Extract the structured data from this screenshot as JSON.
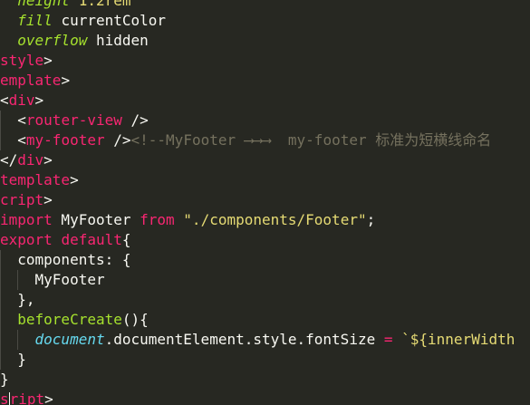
{
  "editor": {
    "theme": "monokai",
    "colors": {
      "background": "#272822",
      "text": "#f8f8f2",
      "tag": "#f92672",
      "keyword": "#f92672",
      "function": "#a6e22e",
      "string": "#e6db74",
      "comment": "#75715e",
      "builtin": "#66d9ef"
    }
  },
  "code": {
    "l1": {
      "prop": "height",
      "value": "1.2rem"
    },
    "l2": {
      "prop": "fill",
      "value": "currentColor"
    },
    "l3": {
      "prop": "overflow",
      "value": "hidden"
    },
    "l4": {
      "name": "style",
      "close": ">"
    },
    "l5": {
      "name": "emplate",
      "close": ">"
    },
    "l6": {
      "open": "<",
      "name": "div",
      "close": ">"
    },
    "l7": {
      "open": "<",
      "name": "router-view",
      "close": " />"
    },
    "l8": {
      "open": "<",
      "name": "my-footer",
      "close": " />",
      "comment": "<!--MyFooter ⟶⟶⟶  my-footer 标准为短横线命名"
    },
    "l9": {
      "open": "</",
      "name": "div",
      "close": ">"
    },
    "l10": {
      "name": "template",
      "close": ">"
    },
    "l11": {
      "name": "cript",
      "close": ">"
    },
    "l12": {
      "kw1": "import",
      "ident": " MyFooter ",
      "kw2": "from",
      "sp": " ",
      "str": "\"./components/Footer\"",
      "semi": ";"
    },
    "l13": {
      "kw1": "export",
      "sp": " ",
      "kw2": "default",
      "brace": "{"
    },
    "l14": {
      "text": "components: {"
    },
    "l15": {
      "text": "MyFooter"
    },
    "l16": {
      "text": "},"
    },
    "l17": {
      "func": "beforeCreate",
      "rest": "(){"
    },
    "l18": {
      "obj": "document",
      "rest": ".documentElement.style.fontSize ",
      "op": "=",
      "sp": " ",
      "str": "`${innerWidth"
    },
    "l19": {
      "text": "}"
    },
    "l20": {
      "text": "}"
    },
    "l21": {
      "pre": "s",
      "post": "ript",
      "close": ">"
    }
  }
}
